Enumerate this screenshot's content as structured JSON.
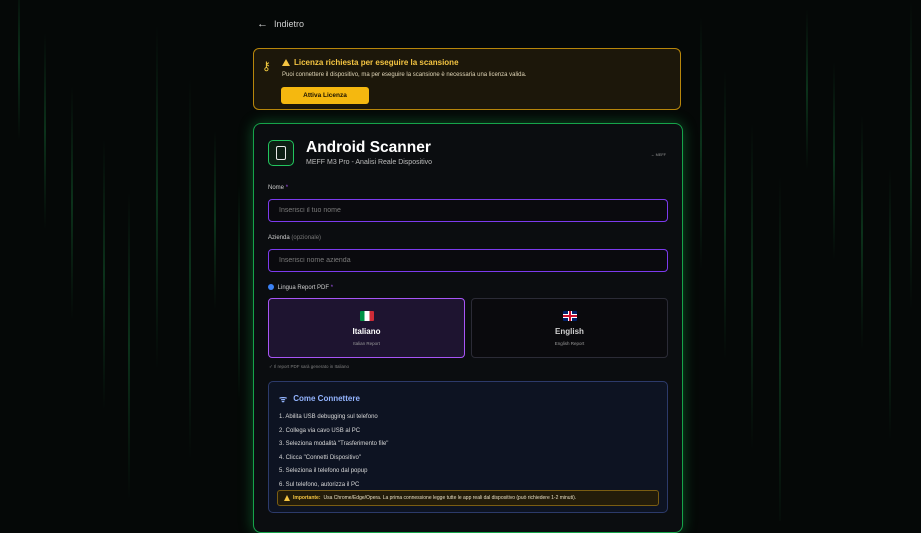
{
  "nav": {
    "back_label": "Indietro"
  },
  "license_banner": {
    "title": "Licenza richiesta per eseguire la scansione",
    "description": "Puoi connettere il dispositivo, ma per eseguire la scansione è necessaria una licenza valida.",
    "button_label": "Attiva Licenza",
    "accent_color": "#f5b80f"
  },
  "scanner": {
    "title": "Android Scanner",
    "subtitle": "MEFF M3 Pro - Analisi Reale Dispositivo",
    "badge": "← MEFF",
    "accent_color": "#22c55e"
  },
  "form": {
    "name": {
      "label": "Nome",
      "required_mark": "*",
      "placeholder": "Inserisci il tuo nome",
      "value": ""
    },
    "company": {
      "label": "Azienda",
      "optional_text": "(opzionale)",
      "placeholder": "Inserisci nome azienda",
      "value": ""
    },
    "language": {
      "label": "Lingua Report PDF",
      "required_mark": "*",
      "options": [
        {
          "name": "Italiano",
          "sub": "Italian Report",
          "selected": true,
          "flag": "italy-flag-icon"
        },
        {
          "name": "English",
          "sub": "English Report",
          "selected": false,
          "flag": "uk-flag-icon"
        }
      ],
      "note": "✓ Il report PDF sarà generato in Italiano"
    }
  },
  "how_to": {
    "title": "Come Connettere",
    "steps": [
      "1. Abilita USB debugging sul telefono",
      "2. Collega via cavo USB al PC",
      "3. Seleziona modalità \"Trasferimento file\"",
      "4. Clicca \"Connetti Dispositivo\"",
      "5. Seleziona il telefono dal popup",
      "6. Sul telefono, autorizza il PC"
    ],
    "important_label": "Importante:",
    "important_text": "Usa Chrome/Edge/Opera. La prima connessione legge tutte le app reali dal dispositivo (può richiedere 1-2 minuti)."
  }
}
